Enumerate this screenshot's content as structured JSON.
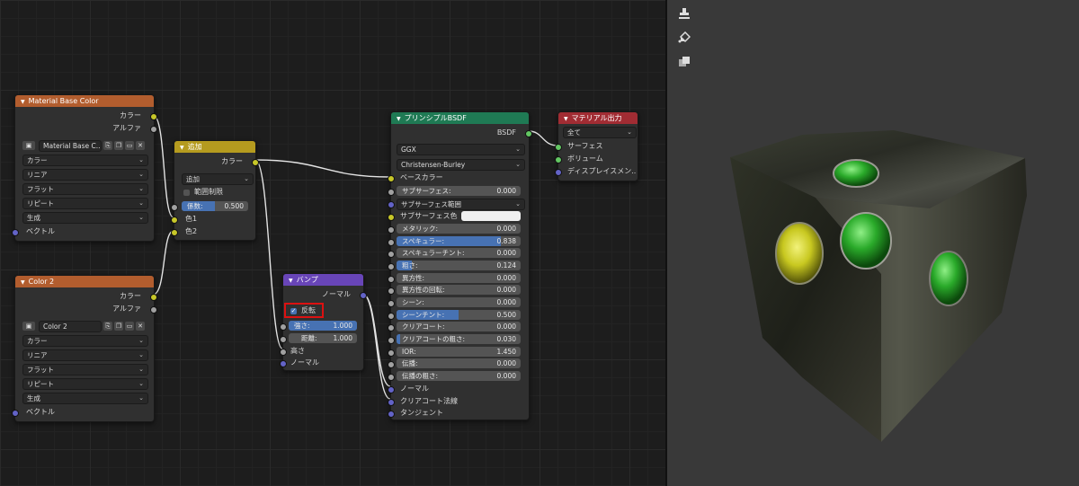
{
  "nodes": {
    "material_base_color": {
      "title": "Material Base Color",
      "outputs": [
        "カラー",
        "アルファ"
      ],
      "image_name": "Material Base C..",
      "options": [
        "カラー",
        "リニア",
        "フラット",
        "リピート",
        "生成"
      ],
      "input": "ベクトル"
    },
    "color2": {
      "title": "Color 2",
      "outputs": [
        "カラー",
        "アルファ"
      ],
      "image_name": "Color 2",
      "options": [
        "カラー",
        "リニア",
        "フラット",
        "リピート",
        "生成"
      ],
      "input": "ベクトル"
    },
    "mix": {
      "title": "追加",
      "output": "カラー",
      "blend_mode": "追加",
      "clamp_label": "範囲制限",
      "factor_label": "係数:",
      "factor_value": "0.500",
      "factor": 0.5,
      "inputs": [
        "色1",
        "色2"
      ]
    },
    "bump": {
      "title": "バンプ",
      "output": "ノーマル",
      "invert_label": "反転",
      "invert_checked": true,
      "strength_label": "強さ:",
      "strength_value": "1.000",
      "strength": 1.0,
      "distance_label": "距離:",
      "distance_value": "1.000",
      "inputs": [
        "高さ",
        "ノーマル"
      ]
    },
    "bsdf": {
      "title": "プリンシプルBSDF",
      "output": "BSDF",
      "distribution": "GGX",
      "subsurface_method": "Christensen-Burley",
      "base_color": "ベースカラー",
      "subsurface": {
        "label": "サブサーフェス:",
        "value": "0.000"
      },
      "subsurface_radius": "サブサーフェス範囲",
      "subsurface_color": "サブサーフェス色",
      "fields": [
        {
          "label": "メタリック:",
          "value": "0.000",
          "fill": 0
        },
        {
          "label": "スペキュラー:",
          "value": "0.838",
          "fill": 0.838
        },
        {
          "label": "スペキュラーチント:",
          "value": "0.000",
          "fill": 0
        },
        {
          "label": "粗さ:",
          "value": "0.124",
          "fill": 0.124
        },
        {
          "label": "異方性:",
          "value": "0.000",
          "fill": 0
        },
        {
          "label": "異方性の回転:",
          "value": "0.000",
          "fill": 0
        },
        {
          "label": "シーン:",
          "value": "0.000",
          "fill": 0
        },
        {
          "label": "シーンチント:",
          "value": "0.500",
          "fill": 0.5
        },
        {
          "label": "クリアコート:",
          "value": "0.000",
          "fill": 0
        },
        {
          "label": "クリアコートの粗さ:",
          "value": "0.030",
          "fill": 0.03
        },
        {
          "label": "IOR:",
          "value": "1.450",
          "fill": 0
        },
        {
          "label": "伝播:",
          "value": "0.000",
          "fill": 0
        },
        {
          "label": "伝播の粗さ:",
          "value": "0.000",
          "fill": 0
        }
      ],
      "inputs_bottom": [
        "ノーマル",
        "クリアコート法線",
        "タンジェント"
      ]
    },
    "output": {
      "title": "マテリアル出力",
      "target": "全て",
      "inputs": [
        "サーフェス",
        "ボリューム",
        "ディスプレイスメン.."
      ]
    }
  },
  "viewport": {
    "tools": [
      "stamp-icon",
      "paint-bucket-icon",
      "layers-icon"
    ]
  },
  "colors": {
    "input_header": "#b25d2e",
    "color_header": "#b59b1f",
    "vector_header": "#6845b8",
    "shader_header": "#1f7a54",
    "output_header": "#a12c33",
    "accent": "#4772b3"
  }
}
